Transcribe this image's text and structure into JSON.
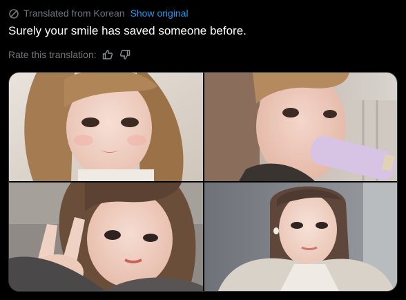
{
  "translation": {
    "label": "Translated from Korean",
    "show_original": "Show original",
    "icon": "translate-icon"
  },
  "tweet": {
    "text": "Surely your smile has saved someone before."
  },
  "rating": {
    "label": "Rate this translation:",
    "like_icon": "thumbs-up-icon",
    "dislike_icon": "thumbs-down-icon"
  },
  "media": {
    "count": 4,
    "photos": [
      {
        "name": "photo-1"
      },
      {
        "name": "photo-2"
      },
      {
        "name": "photo-3"
      },
      {
        "name": "photo-4"
      }
    ]
  },
  "colors": {
    "background": "#000000",
    "text": "#ffffff",
    "muted": "#71767b",
    "link": "#1d9bf0",
    "border": "#2f3336"
  }
}
